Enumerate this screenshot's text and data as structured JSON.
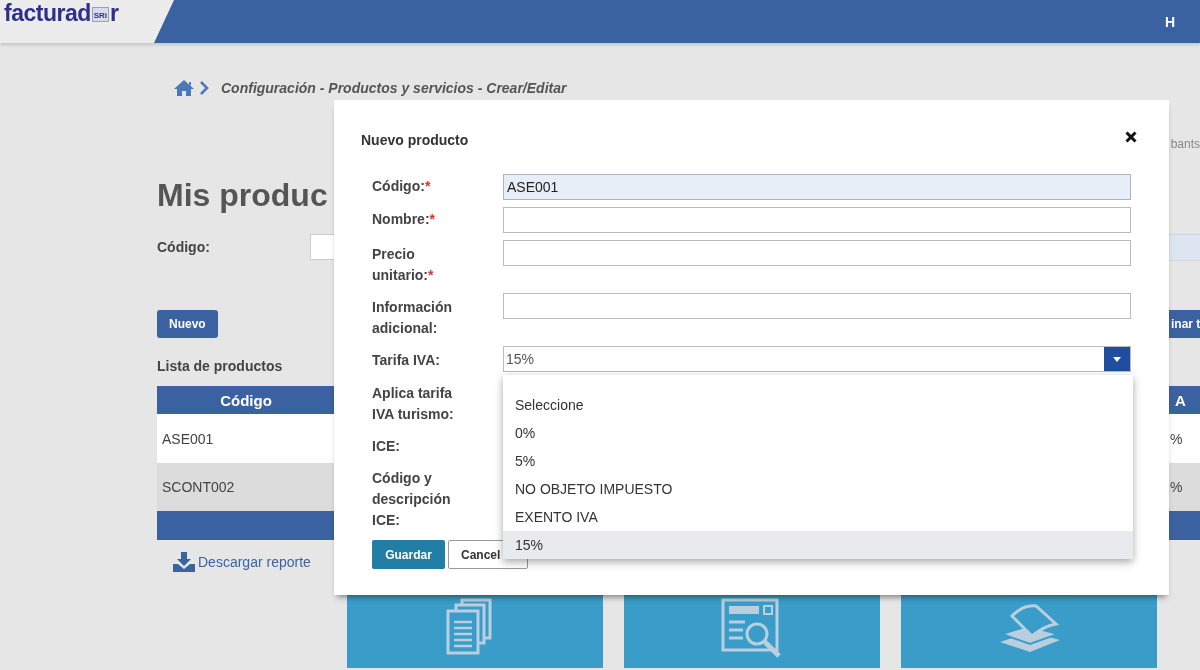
{
  "header": {
    "logo_text_left": "facturad",
    "logo_badge": "SRi",
    "logo_text_right": "r",
    "user_initial": "H"
  },
  "breadcrumb": "Configuración - Productos y servicios - Crear/Editar",
  "right_note": "bants",
  "page_title": "Mis produc",
  "filter": {
    "label": "Código:"
  },
  "new_button": "Nuevo",
  "side_button": "inar t",
  "list_title": "Lista de productos",
  "table": {
    "columns": [
      "Código",
      "A"
    ],
    "rows": [
      [
        "ASE001",
        "%"
      ],
      [
        "SCONT002",
        "%"
      ]
    ]
  },
  "download_link": "Descargar reporte",
  "tiles": [
    {
      "kind": "documents"
    },
    {
      "kind": "search"
    },
    {
      "kind": "papers"
    }
  ],
  "modal": {
    "title": "Nuevo producto",
    "fields": [
      {
        "label": "Código:",
        "required_mark": "*",
        "kind": "text",
        "value": "ASE001",
        "focused": true
      },
      {
        "label": "Nombre:",
        "required_mark": "*",
        "kind": "text",
        "focused": false
      },
      {
        "label": "Precio unitario:",
        "required_mark": "*",
        "kind": "text",
        "focused": false
      },
      {
        "label": "Información adicional:",
        "kind": "text",
        "focused": false
      },
      {
        "label": "Tarifa IVA:",
        "kind": "select",
        "value": "15%",
        "expanded": true
      },
      {
        "label": "Aplica tarifa IVA turismo:",
        "kind": "covered"
      },
      {
        "label": "ICE:",
        "kind": "covered"
      },
      {
        "label": "Código y descripción ICE:",
        "kind": "covered"
      }
    ],
    "options": [
      {
        "label": "Seleccione",
        "selected": false
      },
      {
        "label": "0%",
        "selected": false
      },
      {
        "label": "5%",
        "selected": false
      },
      {
        "label": "NO OBJETO IMPUESTO",
        "selected": false
      },
      {
        "label": "EXENTO IVA",
        "selected": false
      },
      {
        "label": "15%",
        "selected": true
      }
    ],
    "buttons": [
      {
        "label": "Guardar",
        "kind": "primary"
      },
      {
        "label": "Cancel",
        "kind": "secondary"
      }
    ]
  }
}
